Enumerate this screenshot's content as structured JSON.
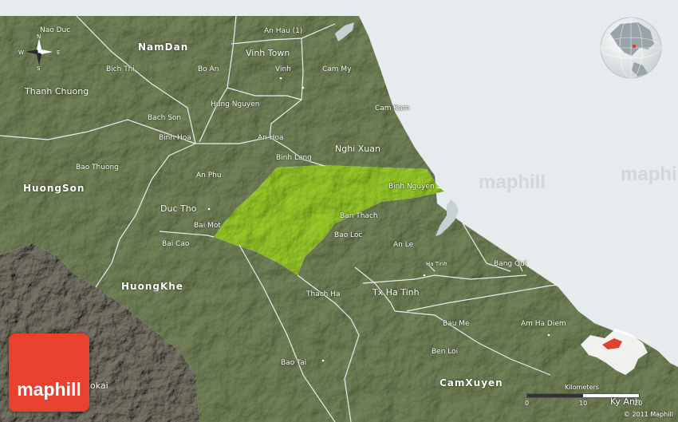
{
  "colors": {
    "sea": "#e6ebee",
    "land": "#76875b",
    "highlight": "#9ccf2a",
    "mountain": "#7b756b",
    "logo": "#e8412e",
    "inset_region": "#d9432f"
  },
  "labels": {
    "nam_dan": "NamDan",
    "nao_duc": "Nao Duc",
    "an_hau": "An Hau (1)",
    "vinh_town": "Vinh Town",
    "vinh": "Vinh",
    "bo_an": "Bo An",
    "cam_my": "Cam My",
    "bich_thi": "Bich Thi",
    "thanh_chuong": "Thanh Chuong",
    "hung_nguyen": "Hung Nguyen",
    "cam_kam": "Cam Kam",
    "bach_son": "Bach Son",
    "binh_hoa": "Binh Hoa",
    "an_hoa": "An Hoa",
    "nghi_xuan": "Nghi Xuan",
    "binh_lang": "Binh Lang",
    "bao_thuong": "Bao Thuong",
    "an_phu": "An Phu",
    "huong_son": "HuongSon",
    "duc_tho": "Duc Tho",
    "binh_nguyen": "Binh Nguyen",
    "bai_mot": "Bai Mot",
    "ban_thach": "Ban Thach",
    "bao_loc": "Bao Loc",
    "bai_cao": "Bai Cao",
    "an_le": "An Le",
    "ha_tinh": "Ha Tinh",
    "bang_qui": "Bang Qui",
    "huong_khe": "HuongKhe",
    "thach_ha": "Thach Ha",
    "tx_ha_tinh": "Tx.Ha Tinh",
    "bau_me": "Bau Me",
    "am_ha_diem": "Am Ha Diem",
    "ben_loi": "Ben Loi",
    "bao_tai": "Bao Tai",
    "cam_xuyen": "CamXuyen",
    "ky_anh": "Ky Anh",
    "okai": "okai"
  },
  "compass": {
    "n": "N",
    "s": "S",
    "e": "E",
    "w": "W"
  },
  "logo": {
    "text": "maphill",
    "icon": "maphill-logo-icon"
  },
  "watermark": "maphill",
  "scale": {
    "title": "Kilometers",
    "ticks": [
      "0",
      "10",
      "20"
    ]
  },
  "copyright": "© 2011 Maphill",
  "icons": {
    "compass": "compass-rose-icon",
    "globe": "globe-locator-icon",
    "inset": "inset-region-map-icon"
  }
}
